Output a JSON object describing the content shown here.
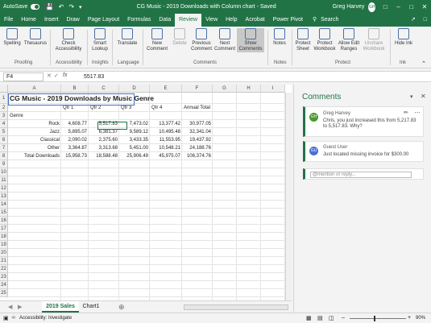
{
  "titlebar": {
    "autosave_label": "AutoSave",
    "autosave_state": "On",
    "doc_title": "CG Music - 2019 Downloads with Column chart - Saved",
    "user": "Greg Harvey",
    "user_initials": "GH",
    "accent_color": "#217346"
  },
  "ribbon_tabs": [
    "File",
    "Home",
    "Insert",
    "Draw",
    "Page Layout",
    "Formulas",
    "Data",
    "Review",
    "View",
    "Help",
    "Acrobat",
    "Power Pivot"
  ],
  "ribbon_active_tab": "Review",
  "search_label": "Search",
  "ribbon": {
    "spelling": "Spelling",
    "thesaurus": "Thesaurus",
    "check_access": "Check Accessibility",
    "smart_lookup": "Smart Lookup",
    "translate": "Translate",
    "new_comment": "New Comment",
    "delete": "Delete",
    "previous_comment": "Previous Comment",
    "next_comment": "Next Comment",
    "show_comments": "Show Comments",
    "notes": "Notes",
    "protect_sheet": "Protect Sheet",
    "protect_workbook": "Protect Workbook",
    "allow_edit_ranges": "Allow Edit Ranges",
    "unshare_workbook": "Unshare Workbook",
    "hide_ink": "Hide Ink",
    "groups": [
      "Proofing",
      "Accessibility",
      "Insights",
      "Language",
      "Comments",
      "Notes",
      "Protect",
      "Ink"
    ]
  },
  "formula_bar": {
    "name_box": "F4",
    "fx": "fx",
    "value": "5517.83"
  },
  "columns": [
    "A",
    "B",
    "C",
    "D",
    "E",
    "F",
    "G",
    "H",
    "I"
  ],
  "rows": [
    "1",
    "2",
    "3",
    "4",
    "5",
    "6",
    "7",
    "8",
    "9",
    "10",
    "11",
    "12",
    "13",
    "14",
    "15",
    "16",
    "17",
    "18",
    "19",
    "20",
    "21",
    "22",
    "23",
    "24",
    "25"
  ],
  "sheet": {
    "title": "CG Music - 2019 Downloads by Music Genre",
    "headers": [
      "Qtr 1",
      "Qtr 2",
      "Qtr 3",
      "Qtr 4",
      "Annual Total"
    ],
    "genre_label": "Genre",
    "data_rows": [
      {
        "label": "Rock",
        "values": [
          "4,608.77",
          "5,517.83",
          "7,473.02",
          "13,377.42",
          "30,977.05"
        ]
      },
      {
        "label": "Jazz",
        "values": [
          "5,895.07",
          "6,381.37",
          "9,589.12",
          "10,495.48",
          "32,341.04"
        ]
      },
      {
        "label": "Classical",
        "values": [
          "2,090.02",
          "2,375.60",
          "3,433.35",
          "11,553.95",
          "19,437.92"
        ]
      },
      {
        "label": "Other",
        "values": [
          "3,364.87",
          "3,313.68",
          "5,451.00",
          "10,548.21",
          "24,188.76"
        ]
      },
      {
        "label": "Total Downloads",
        "values": [
          "15,958.73",
          "18,588.48",
          "25,906.49",
          "45,975.07",
          "106,374.76"
        ]
      }
    ]
  },
  "sheet_tabs": [
    "2019 Sales",
    "Chart1"
  ],
  "status": {
    "accessibility": "Accessibility: Investigate",
    "zoom": "90%"
  },
  "comments_pane": {
    "title": "Comments",
    "comments": [
      {
        "author": "Greg Harvey",
        "initials": "GH",
        "text": "Chris, you just increased this from 5,217.83 to 5,517.83. Why?",
        "color": "#4a9a2a"
      },
      {
        "author": "Guest User",
        "initials": "GU",
        "text": "Just located missing invoice for $300.00",
        "color": "#4a6fd4"
      }
    ],
    "reply_placeholder": "@mention or reply..."
  }
}
